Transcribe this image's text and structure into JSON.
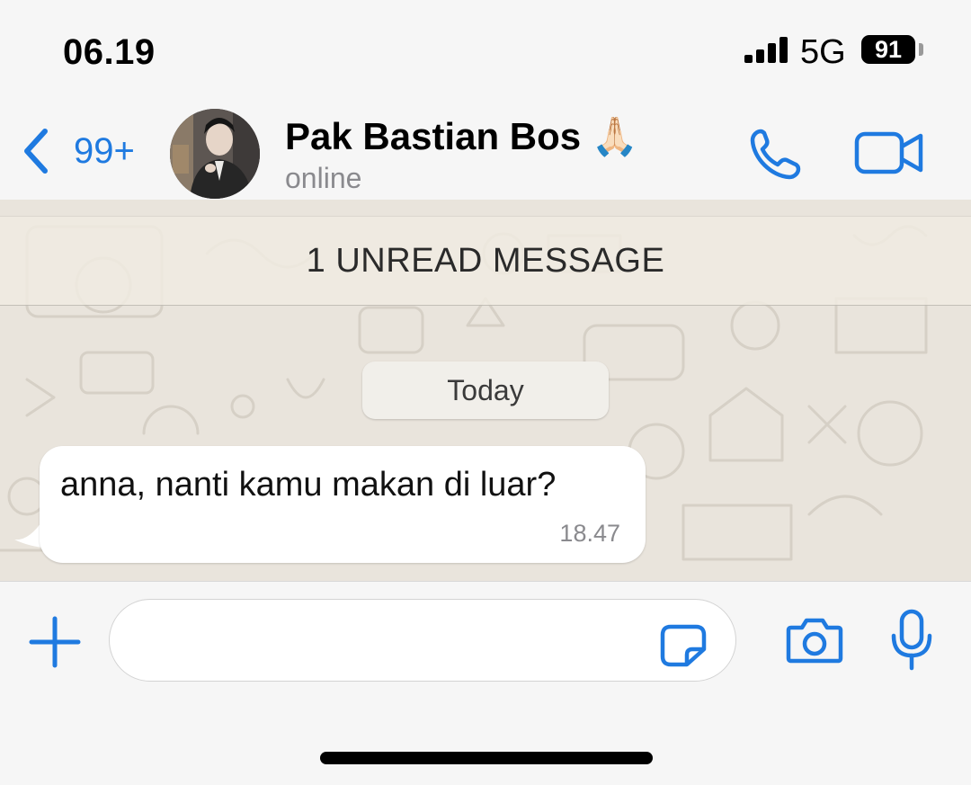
{
  "status_bar": {
    "time": "06.19",
    "network": "5G",
    "battery": "91"
  },
  "header": {
    "back_count": "99+",
    "contact_name": "Pak Bastian Bos 🙏🏻",
    "contact_status": "online"
  },
  "chat": {
    "unread_banner": "1 UNREAD MESSAGE",
    "date_chip": "Today",
    "messages": [
      {
        "text": "anna, nanti kamu makan di luar?",
        "time": "18.47",
        "direction": "incoming"
      }
    ]
  },
  "composer": {
    "value": "",
    "placeholder": ""
  },
  "icons": {
    "back": "chevron-left-icon",
    "call": "phone-icon",
    "video": "video-camera-icon",
    "attach": "plus-icon",
    "sticker": "sticker-icon",
    "camera": "camera-icon",
    "mic": "microphone-icon"
  },
  "colors": {
    "accent": "#1f7ae0",
    "chat_wallpaper": "#e9e4dc",
    "bubble_incoming": "#ffffff",
    "unread_banner_bg": "#f0ebe2"
  }
}
